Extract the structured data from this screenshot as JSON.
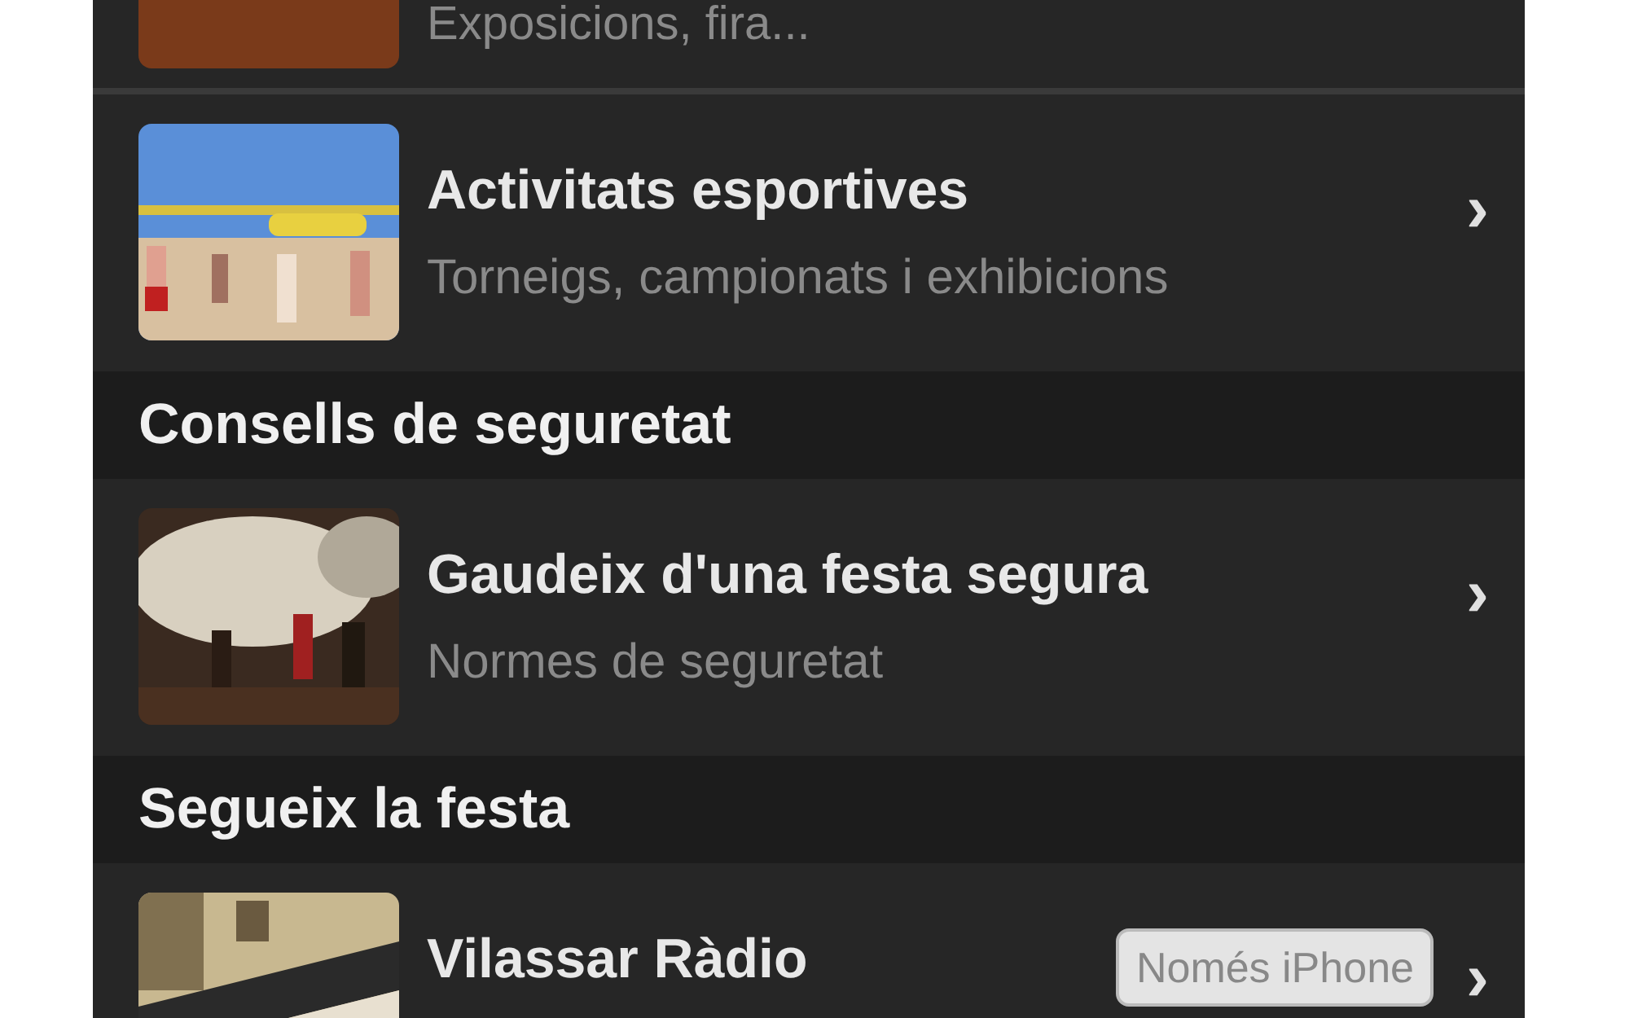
{
  "items": [
    {
      "kind": "row_cut",
      "subtitle": "Exposicions, fira..."
    },
    {
      "kind": "row",
      "title": "Activitats esportives",
      "subtitle": "Torneigs, campionats i exhibicions",
      "chevron": "›"
    },
    {
      "kind": "section",
      "title": "Consells de seguretat"
    },
    {
      "kind": "row",
      "title": "Gaudeix d'una festa segura",
      "subtitle": "Normes de seguretat",
      "chevron": "›"
    },
    {
      "kind": "section",
      "title": "Segueix la festa"
    },
    {
      "kind": "row",
      "title": "Vilassar Ràdio",
      "badge": "Només iPhone",
      "chevron": "›"
    }
  ]
}
